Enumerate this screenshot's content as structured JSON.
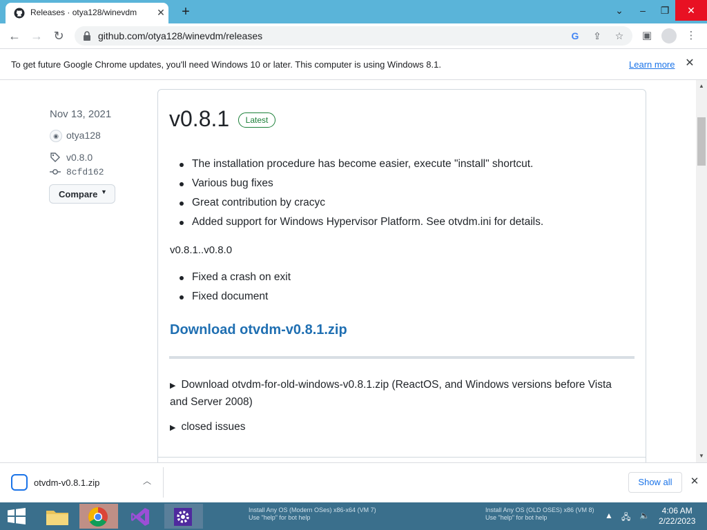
{
  "browser": {
    "tab_title": "Releases · otya128/winevdm",
    "url": "github.com/otya128/winevdm/releases",
    "infobar_text": "To get future Google Chrome updates, you'll need Windows 10 or later. This computer is using Windows 8.1.",
    "infobar_link": "Learn more"
  },
  "release": {
    "date": "Nov 13, 2021",
    "author": "otya128",
    "tag": "v0.8.0",
    "commit": "8cfd162",
    "compare_label": "Compare",
    "title": "v0.8.1",
    "badge": "Latest",
    "notes": [
      "The installation procedure has become easier, execute \"install\" shortcut.",
      "Various bug fixes",
      "Great contribution by cracyc",
      "Added support for Windows Hypervisor Platform. See otvdm.ini for details."
    ],
    "range": "v0.8.1..v0.8.0",
    "fixes": [
      "Fixed a crash on exit",
      "Fixed document"
    ],
    "download_link": "Download otvdm-v0.8.1.zip",
    "old_windows": "Download otvdm-for-old-windows-v0.8.1.zip (ReactOS, and Windows versions before Vista and Server 2008)",
    "closed_issues": "closed issues"
  },
  "downloads": {
    "file": "otvdm-v0.8.1.zip",
    "show_all": "Show all"
  },
  "taskbar": {
    "vm1_title": "Install Any OS (Modern OSes) x86-x64 (VM 7)",
    "vm1_sub": "Use \"help\" for bot help",
    "vm2_title": "Install Any OS (OLD OSES) x86 (VM 8)",
    "vm2_sub": "Use \"help\" for bot help",
    "time": "4:06 AM",
    "date": "2/22/2023"
  }
}
